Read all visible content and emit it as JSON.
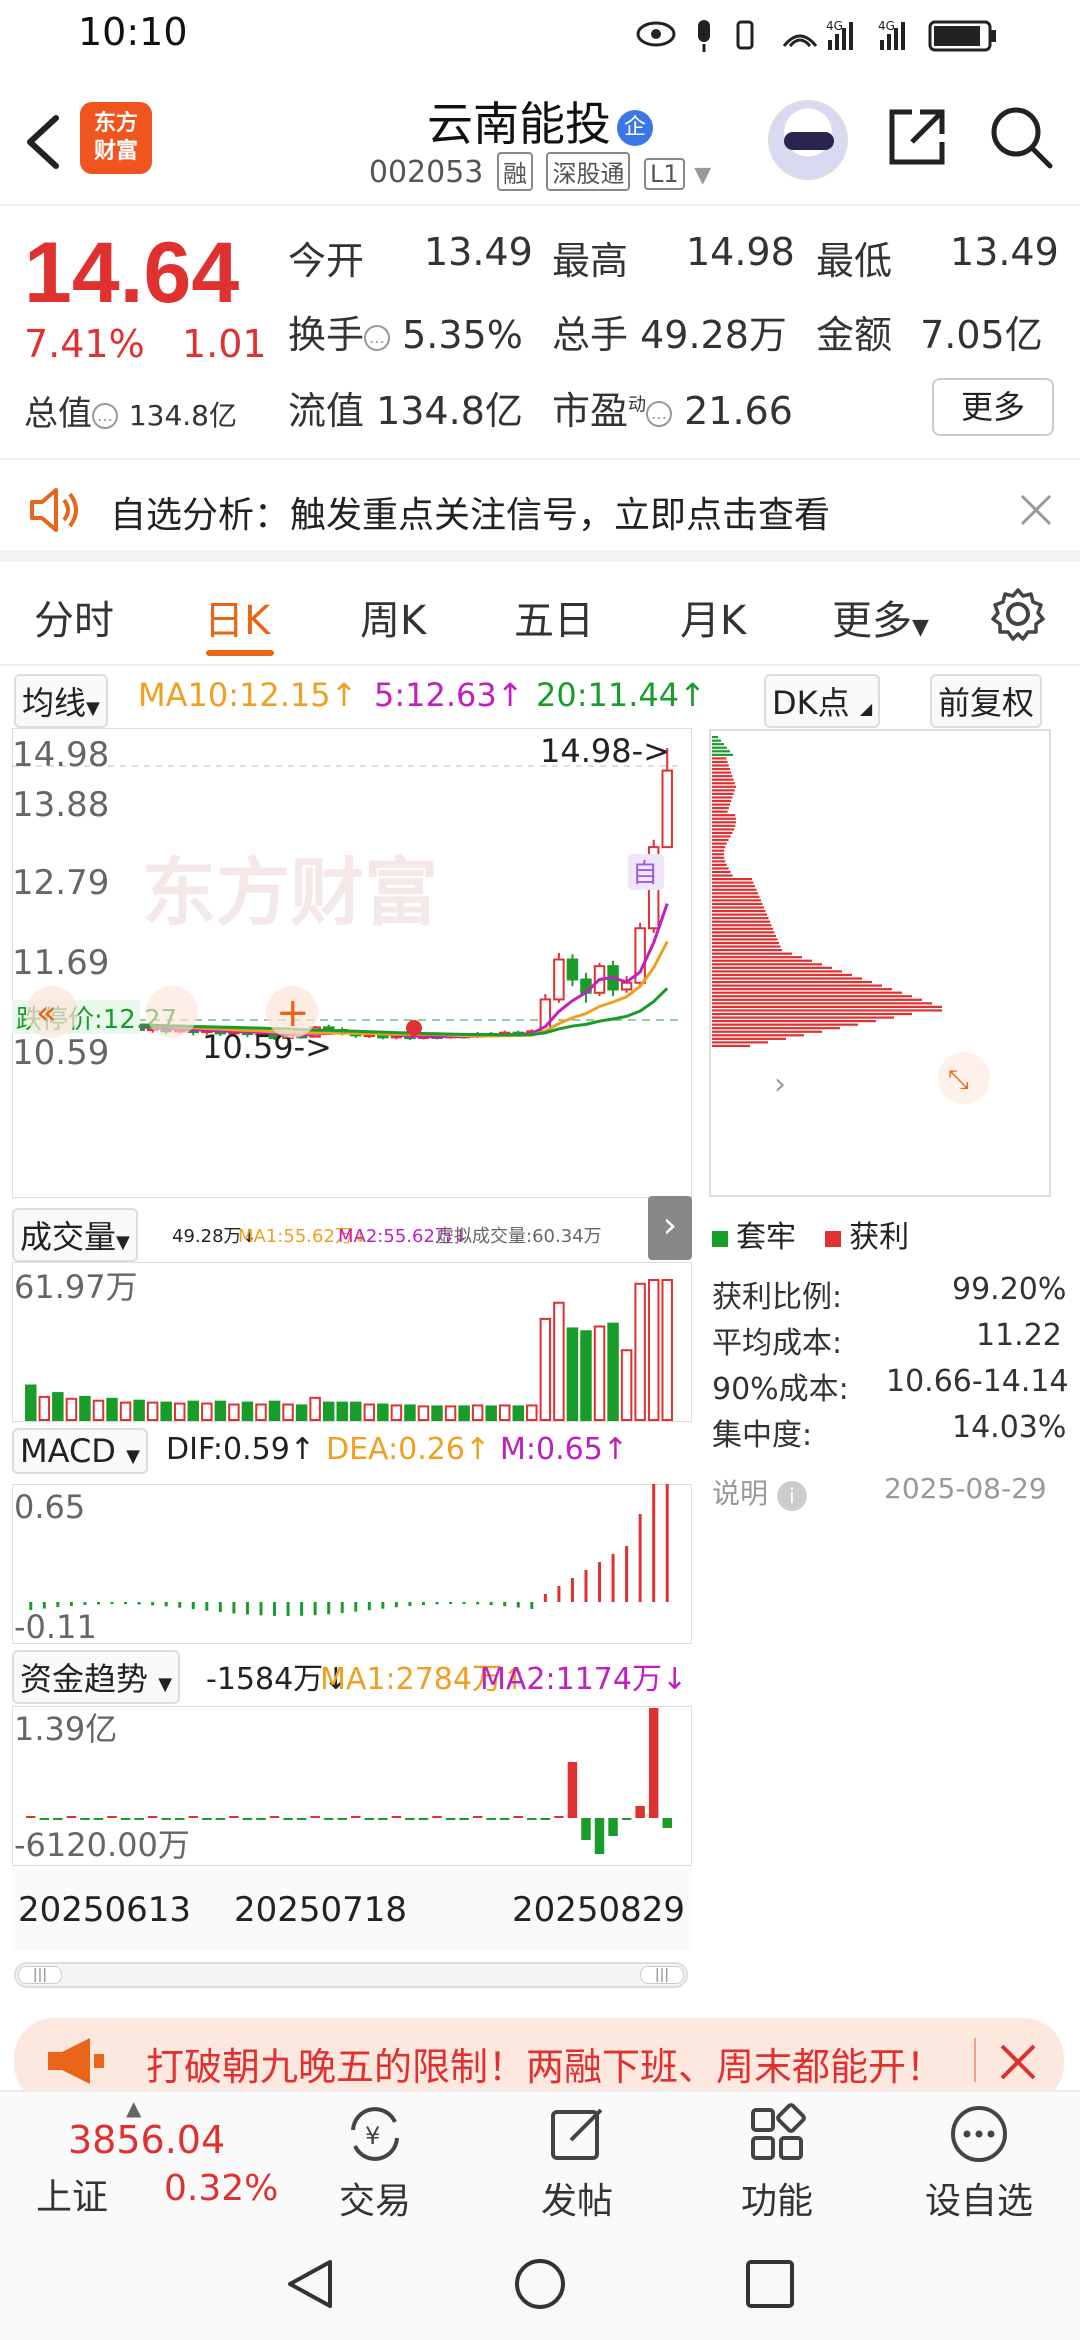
{
  "status_bar": {
    "time": "10:10",
    "signal_labels": [
      "4G",
      "4G"
    ]
  },
  "header": {
    "back_icon": "chevron-left-icon",
    "logo_text": "东方\n财富",
    "stock_name": "云南能投",
    "badge": "企",
    "code": "002053",
    "tags": [
      "融",
      "深股通",
      "L1"
    ]
  },
  "quote": {
    "price": "14.64",
    "change_pct": "7.41%",
    "change": "1.01",
    "total_value_label": "总值",
    "total_value": "134.8亿",
    "open_label": "今开",
    "open": "13.49",
    "high_label": "最高",
    "high": "14.98",
    "low_label": "最低",
    "low": "13.49",
    "turnover_label": "换手",
    "turnover": "5.35%",
    "volume_label": "总手",
    "volume": "49.28万",
    "amount_label": "金额",
    "amount": "7.05亿",
    "float_label": "流值",
    "float_value": "134.8亿",
    "pe_label": "市盈",
    "pe_sup": "动",
    "pe": "21.66",
    "more": "更多"
  },
  "notice": {
    "text": "自选分析：触发重点关注信号，立即点击查看"
  },
  "tabs": [
    "分时",
    "日K",
    "周K",
    "五日",
    "月K",
    "更多"
  ],
  "active_tab": "日K",
  "ma_row": {
    "selector": "均线",
    "ma10": "MA10:12.15↑",
    "ma5": "5:12.63↑",
    "ma20": "20:11.44↑",
    "dk": "DK点",
    "fq": "前复权"
  },
  "kchart": {
    "y_labels": [
      "14.98",
      "13.88",
      "12.79",
      "11.69",
      "10.59"
    ],
    "high_marker": "14.98->",
    "low_marker": "10.59->",
    "limit_down_label": "跌停价:12.27",
    "self_tag": "自",
    "watermark": "东方财富"
  },
  "volume_row": {
    "selector": "成交量",
    "text": "49.28万↓",
    "ma1": "MA1:55.62万↓",
    "ma2": "MA2:55.62万↓",
    "virtual": "虚拟成交量:60.34万",
    "y_label": "61.97万"
  },
  "macd_row": {
    "selector": "MACD",
    "dif": "DIF:0.59↑",
    "dea": "DEA:0.26↑",
    "m": "M:0.65↑",
    "y_top": "0.65",
    "y_bottom": "-0.11"
  },
  "fund_row": {
    "selector": "资金趋势",
    "val": "-1584万↓",
    "ma1": "MA1:2784万↑",
    "ma2": "MA2:1174万↓",
    "y_top": "1.39亿",
    "y_bottom": "-6120.00万"
  },
  "x_dates": [
    "20250613",
    "20250718",
    "20250829"
  ],
  "chips": {
    "legend_trapped": "套牢",
    "legend_profit": "获利",
    "profit_ratio_label": "获利比例:",
    "profit_ratio": "99.20%",
    "avg_cost_label": "平均成本:",
    "avg_cost": "11.22",
    "cost90_label": "90%成本:",
    "cost90": "10.66-14.14",
    "concentration_label": "集中度:",
    "concentration": "14.03%",
    "note_label": "说明",
    "date": "2025-08-29"
  },
  "ad": {
    "text": "打破朝九晚五的限制！两融下班、周末都能开！"
  },
  "bottom_nav": {
    "index_value": "3856.04",
    "index_name": "上证",
    "index_pct": "0.32%",
    "items": [
      "交易",
      "发帖",
      "功能",
      "设自选"
    ]
  },
  "colors": {
    "up": "#e03131",
    "down": "#1a9c2a",
    "accent": "#e8651a",
    "ma5": "#c020c0",
    "ma10": "#f0a020",
    "ma20": "#1a9c2a"
  },
  "chart_data": {
    "type": "candlestick",
    "ylim": [
      10.59,
      14.98
    ],
    "candles": [
      {
        "o": 10.95,
        "c": 10.85,
        "h": 11.05,
        "l": 10.75
      },
      {
        "o": 10.85,
        "c": 10.92,
        "h": 10.98,
        "l": 10.8
      },
      {
        "o": 10.92,
        "c": 10.8,
        "h": 10.96,
        "l": 10.74
      },
      {
        "o": 10.8,
        "c": 10.86,
        "h": 10.92,
        "l": 10.76
      },
      {
        "o": 10.86,
        "c": 10.78,
        "h": 10.9,
        "l": 10.72
      },
      {
        "o": 10.78,
        "c": 10.83,
        "h": 10.88,
        "l": 10.74
      },
      {
        "o": 10.83,
        "c": 10.76,
        "h": 10.86,
        "l": 10.7
      },
      {
        "o": 10.76,
        "c": 10.8,
        "h": 10.84,
        "l": 10.72
      },
      {
        "o": 10.8,
        "c": 10.74,
        "h": 10.84,
        "l": 10.7
      },
      {
        "o": 10.74,
        "c": 10.78,
        "h": 10.82,
        "l": 10.7
      },
      {
        "o": 10.78,
        "c": 10.72,
        "h": 10.8,
        "l": 10.68
      },
      {
        "o": 10.72,
        "c": 10.76,
        "h": 10.8,
        "l": 10.69
      },
      {
        "o": 10.76,
        "c": 10.71,
        "h": 10.79,
        "l": 10.66
      },
      {
        "o": 10.71,
        "c": 10.74,
        "h": 10.78,
        "l": 10.67
      },
      {
        "o": 10.74,
        "c": 10.69,
        "h": 10.78,
        "l": 10.65
      },
      {
        "o": 10.69,
        "c": 10.73,
        "h": 10.76,
        "l": 10.66
      },
      {
        "o": 10.73,
        "c": 10.68,
        "h": 10.75,
        "l": 10.63
      },
      {
        "o": 10.68,
        "c": 10.7,
        "h": 10.74,
        "l": 10.64
      },
      {
        "o": 10.7,
        "c": 10.62,
        "h": 10.72,
        "l": 10.59
      },
      {
        "o": 10.62,
        "c": 10.66,
        "h": 10.7,
        "l": 10.6
      },
      {
        "o": 10.66,
        "c": 10.64,
        "h": 10.7,
        "l": 10.61
      },
      {
        "o": 10.64,
        "c": 10.78,
        "h": 10.8,
        "l": 10.63
      },
      {
        "o": 10.78,
        "c": 10.74,
        "h": 10.82,
        "l": 10.7
      },
      {
        "o": 10.74,
        "c": 10.7,
        "h": 10.78,
        "l": 10.66
      },
      {
        "o": 10.7,
        "c": 10.66,
        "h": 10.74,
        "l": 10.62
      },
      {
        "o": 10.66,
        "c": 10.68,
        "h": 10.72,
        "l": 10.62
      },
      {
        "o": 10.68,
        "c": 10.63,
        "h": 10.7,
        "l": 10.6
      },
      {
        "o": 10.63,
        "c": 10.66,
        "h": 10.69,
        "l": 10.6
      },
      {
        "o": 10.66,
        "c": 10.62,
        "h": 10.68,
        "l": 10.59
      },
      {
        "o": 10.62,
        "c": 10.65,
        "h": 10.68,
        "l": 10.6
      },
      {
        "o": 10.65,
        "c": 10.63,
        "h": 10.68,
        "l": 10.6
      },
      {
        "o": 10.63,
        "c": 10.66,
        "h": 10.69,
        "l": 10.61
      },
      {
        "o": 10.66,
        "c": 10.64,
        "h": 10.69,
        "l": 10.61
      },
      {
        "o": 10.64,
        "c": 10.68,
        "h": 10.71,
        "l": 10.62
      },
      {
        "o": 10.68,
        "c": 10.66,
        "h": 10.71,
        "l": 10.63
      },
      {
        "o": 10.66,
        "c": 10.7,
        "h": 10.73,
        "l": 10.64
      },
      {
        "o": 10.7,
        "c": 10.68,
        "h": 10.73,
        "l": 10.65
      },
      {
        "o": 10.68,
        "c": 10.72,
        "h": 10.75,
        "l": 10.66
      },
      {
        "o": 10.72,
        "c": 11.2,
        "h": 11.28,
        "l": 10.7
      },
      {
        "o": 11.2,
        "c": 11.8,
        "h": 11.9,
        "l": 11.15
      },
      {
        "o": 11.8,
        "c": 11.5,
        "h": 11.88,
        "l": 11.4
      },
      {
        "o": 11.5,
        "c": 11.3,
        "h": 11.6,
        "l": 11.15
      },
      {
        "o": 11.3,
        "c": 11.7,
        "h": 11.75,
        "l": 11.25
      },
      {
        "o": 11.7,
        "c": 11.35,
        "h": 11.78,
        "l": 11.25
      },
      {
        "o": 11.35,
        "c": 11.45,
        "h": 11.55,
        "l": 11.3
      },
      {
        "o": 11.45,
        "c": 12.27,
        "h": 12.35,
        "l": 11.4
      },
      {
        "o": 12.27,
        "c": 13.49,
        "h": 13.6,
        "l": 12.2
      },
      {
        "o": 13.49,
        "c": 14.64,
        "h": 14.98,
        "l": 13.49
      }
    ],
    "volume": {
      "latest": "49.28万",
      "ylim_label": "61.97万"
    },
    "macd": {
      "dif": 0.59,
      "dea": 0.26,
      "m": 0.65
    }
  }
}
